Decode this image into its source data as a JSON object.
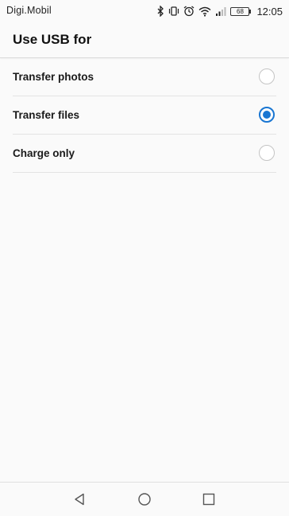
{
  "status_bar": {
    "carrier": "Digi.Mobil",
    "battery_level": "68",
    "time": "12:05",
    "icons": [
      "bluetooth-icon",
      "vibrate-icon",
      "alarm-icon",
      "wifi-icon",
      "signal-icon",
      "battery-icon"
    ]
  },
  "header": {
    "title": "Use USB for"
  },
  "options": [
    {
      "label": "Transfer photos",
      "selected": false
    },
    {
      "label": "Transfer files",
      "selected": true
    },
    {
      "label": "Charge only",
      "selected": false
    }
  ],
  "nav_bar": {
    "icons": [
      "back-icon",
      "home-icon",
      "recents-icon"
    ]
  },
  "colors": {
    "accent": "#1976d2",
    "background": "#fafafa",
    "divider": "#e3e3e3"
  }
}
